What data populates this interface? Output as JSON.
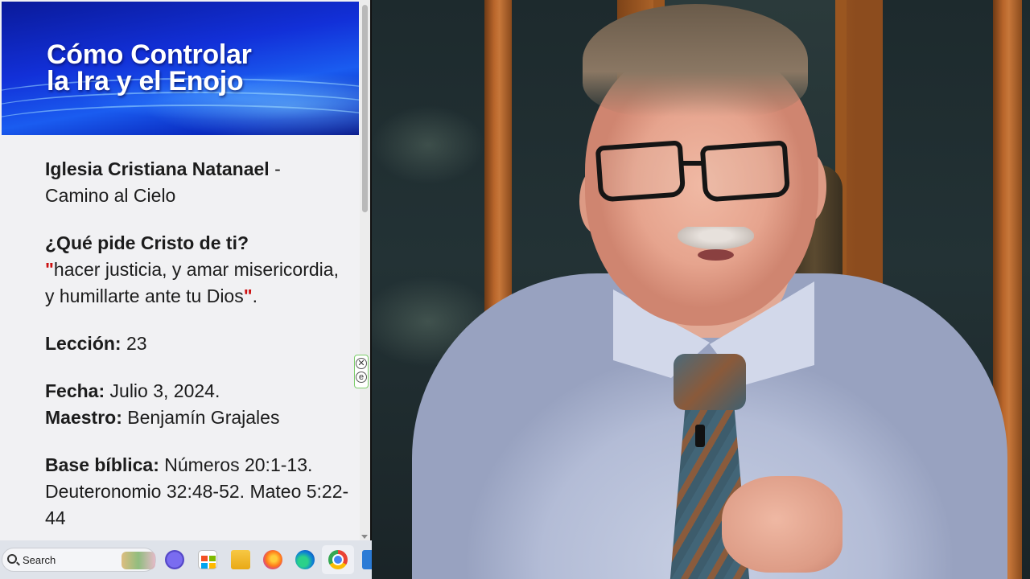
{
  "document": {
    "banner": {
      "title_line1": "Cómo Controlar",
      "title_line2": "la Ira y el Enojo"
    },
    "church": {
      "name": "Iglesia Cristiana Natanael",
      "separator": " -",
      "subtitle": "Camino al Cielo"
    },
    "question": {
      "heading": "¿Qué pide Cristo de ti?",
      "open_quote": "\"",
      "quote_text": "hacer justicia, y amar misericordia, y humillarte ante tu Dios",
      "close_quote": "\"",
      "end_punct": "."
    },
    "lesson": {
      "label": "Lección:",
      "value": " 23"
    },
    "date": {
      "label": "Fecha:",
      "value": " Julio 3, 2024."
    },
    "teacher": {
      "label": "Maestro:",
      "value": " Benjamín Grajales"
    },
    "bible_base": {
      "label": "Base bíblica:",
      "value": " Números 20:1-13. Deuteronomio 32:48-52. Mateo 5:22-44"
    }
  },
  "side_widget": {
    "close_glyph": "✕",
    "edge_glyph": "e"
  },
  "taskbar": {
    "search_placeholder": "Search",
    "icons": [
      "search-icon",
      "meet-icon",
      "store-icon",
      "file-explorer-icon",
      "firefox-icon",
      "edge-icon",
      "chrome-icon"
    ]
  },
  "video": {
    "description_colors": {
      "accent_red": "#cc1111",
      "banner_blue": "#1230d8"
    }
  }
}
